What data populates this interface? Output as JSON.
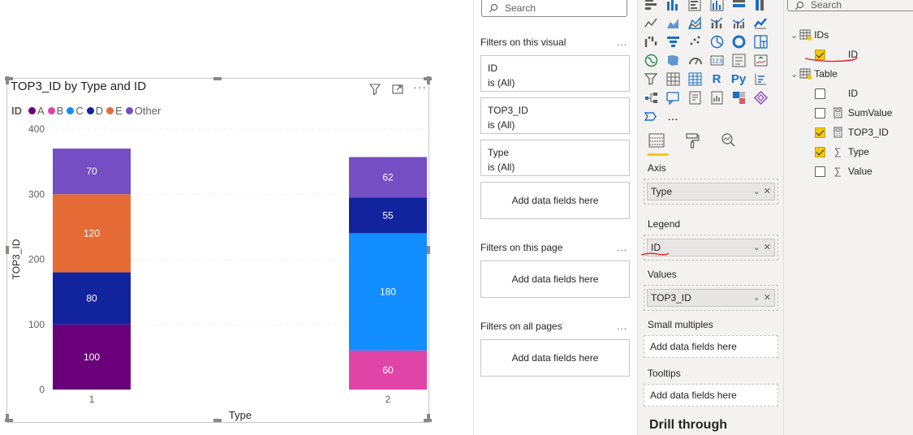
{
  "visual": {
    "title": "TOP3_ID by Type and ID",
    "legend_title": "ID",
    "legend": [
      {
        "name": "A",
        "color": "#6b007b"
      },
      {
        "name": "B",
        "color": "#e044a7"
      },
      {
        "name": "C",
        "color": "#118dff"
      },
      {
        "name": "D",
        "color": "#12239e"
      },
      {
        "name": "E",
        "color": "#e66c37"
      },
      {
        "name": "Other",
        "color": "#744ec2"
      }
    ],
    "icons": [
      "filter-icon",
      "focus-mode-icon",
      "more-options-icon"
    ]
  },
  "chart_data": {
    "type": "bar",
    "stacked": true,
    "title": "TOP3_ID by Type and ID",
    "xlabel": "Type",
    "ylabel": "TOP3_ID",
    "ylim": [
      0,
      400
    ],
    "yticks": [
      "0",
      "100",
      "200",
      "300",
      "400"
    ],
    "categories": [
      "1",
      "2"
    ],
    "series": [
      {
        "name": "A",
        "color": "#6b007b",
        "values": [
          100,
          0
        ]
      },
      {
        "name": "B",
        "color": "#e044a7",
        "values": [
          0,
          60
        ]
      },
      {
        "name": "C",
        "color": "#118dff",
        "values": [
          0,
          180
        ]
      },
      {
        "name": "D",
        "color": "#12239e",
        "values": [
          80,
          55
        ]
      },
      {
        "name": "E",
        "color": "#e66c37",
        "values": [
          120,
          0
        ]
      },
      {
        "name": "Other",
        "color": "#744ec2",
        "values": [
          70,
          62
        ]
      }
    ]
  },
  "filters": {
    "search_placeholder": "Search",
    "on_visual_label": "Filters on this visual",
    "on_page_label": "Filters on this page",
    "on_all_pages_label": "Filters on all pages",
    "more": "...",
    "cards": [
      {
        "field": "ID",
        "state": "is (All)"
      },
      {
        "field": "TOP3_ID",
        "state": "is (All)"
      },
      {
        "field": "Type",
        "state": "is (All)"
      }
    ],
    "add_fields": "Add data fields here"
  },
  "viz": {
    "more_glyph": "...",
    "r_label": "R",
    "py_label": "Py",
    "wells": {
      "axis_label": "Axis",
      "axis_value": "Type",
      "legend_label": "Legend",
      "legend_value": "ID",
      "values_label": "Values",
      "values_value": "TOP3_ID",
      "small_multiples_label": "Small multiples",
      "tooltips_label": "Tooltips",
      "add_fields": "Add data fields here"
    },
    "drill_through": "Drill through"
  },
  "fields": {
    "search_placeholder": "Search",
    "tables": [
      {
        "name": "IDs",
        "fields": [
          {
            "name": "ID",
            "checked": true,
            "type": "none"
          }
        ]
      },
      {
        "name": "Table",
        "fields": [
          {
            "name": "ID",
            "checked": false,
            "type": "none"
          },
          {
            "name": "SumValue",
            "checked": false,
            "type": "calculator"
          },
          {
            "name": "TOP3_ID",
            "checked": true,
            "type": "calculator"
          },
          {
            "name": "Type",
            "checked": true,
            "type": "sigma"
          },
          {
            "name": "Value",
            "checked": false,
            "type": "sigma"
          }
        ]
      }
    ],
    "annotation_color": "#e02020"
  }
}
